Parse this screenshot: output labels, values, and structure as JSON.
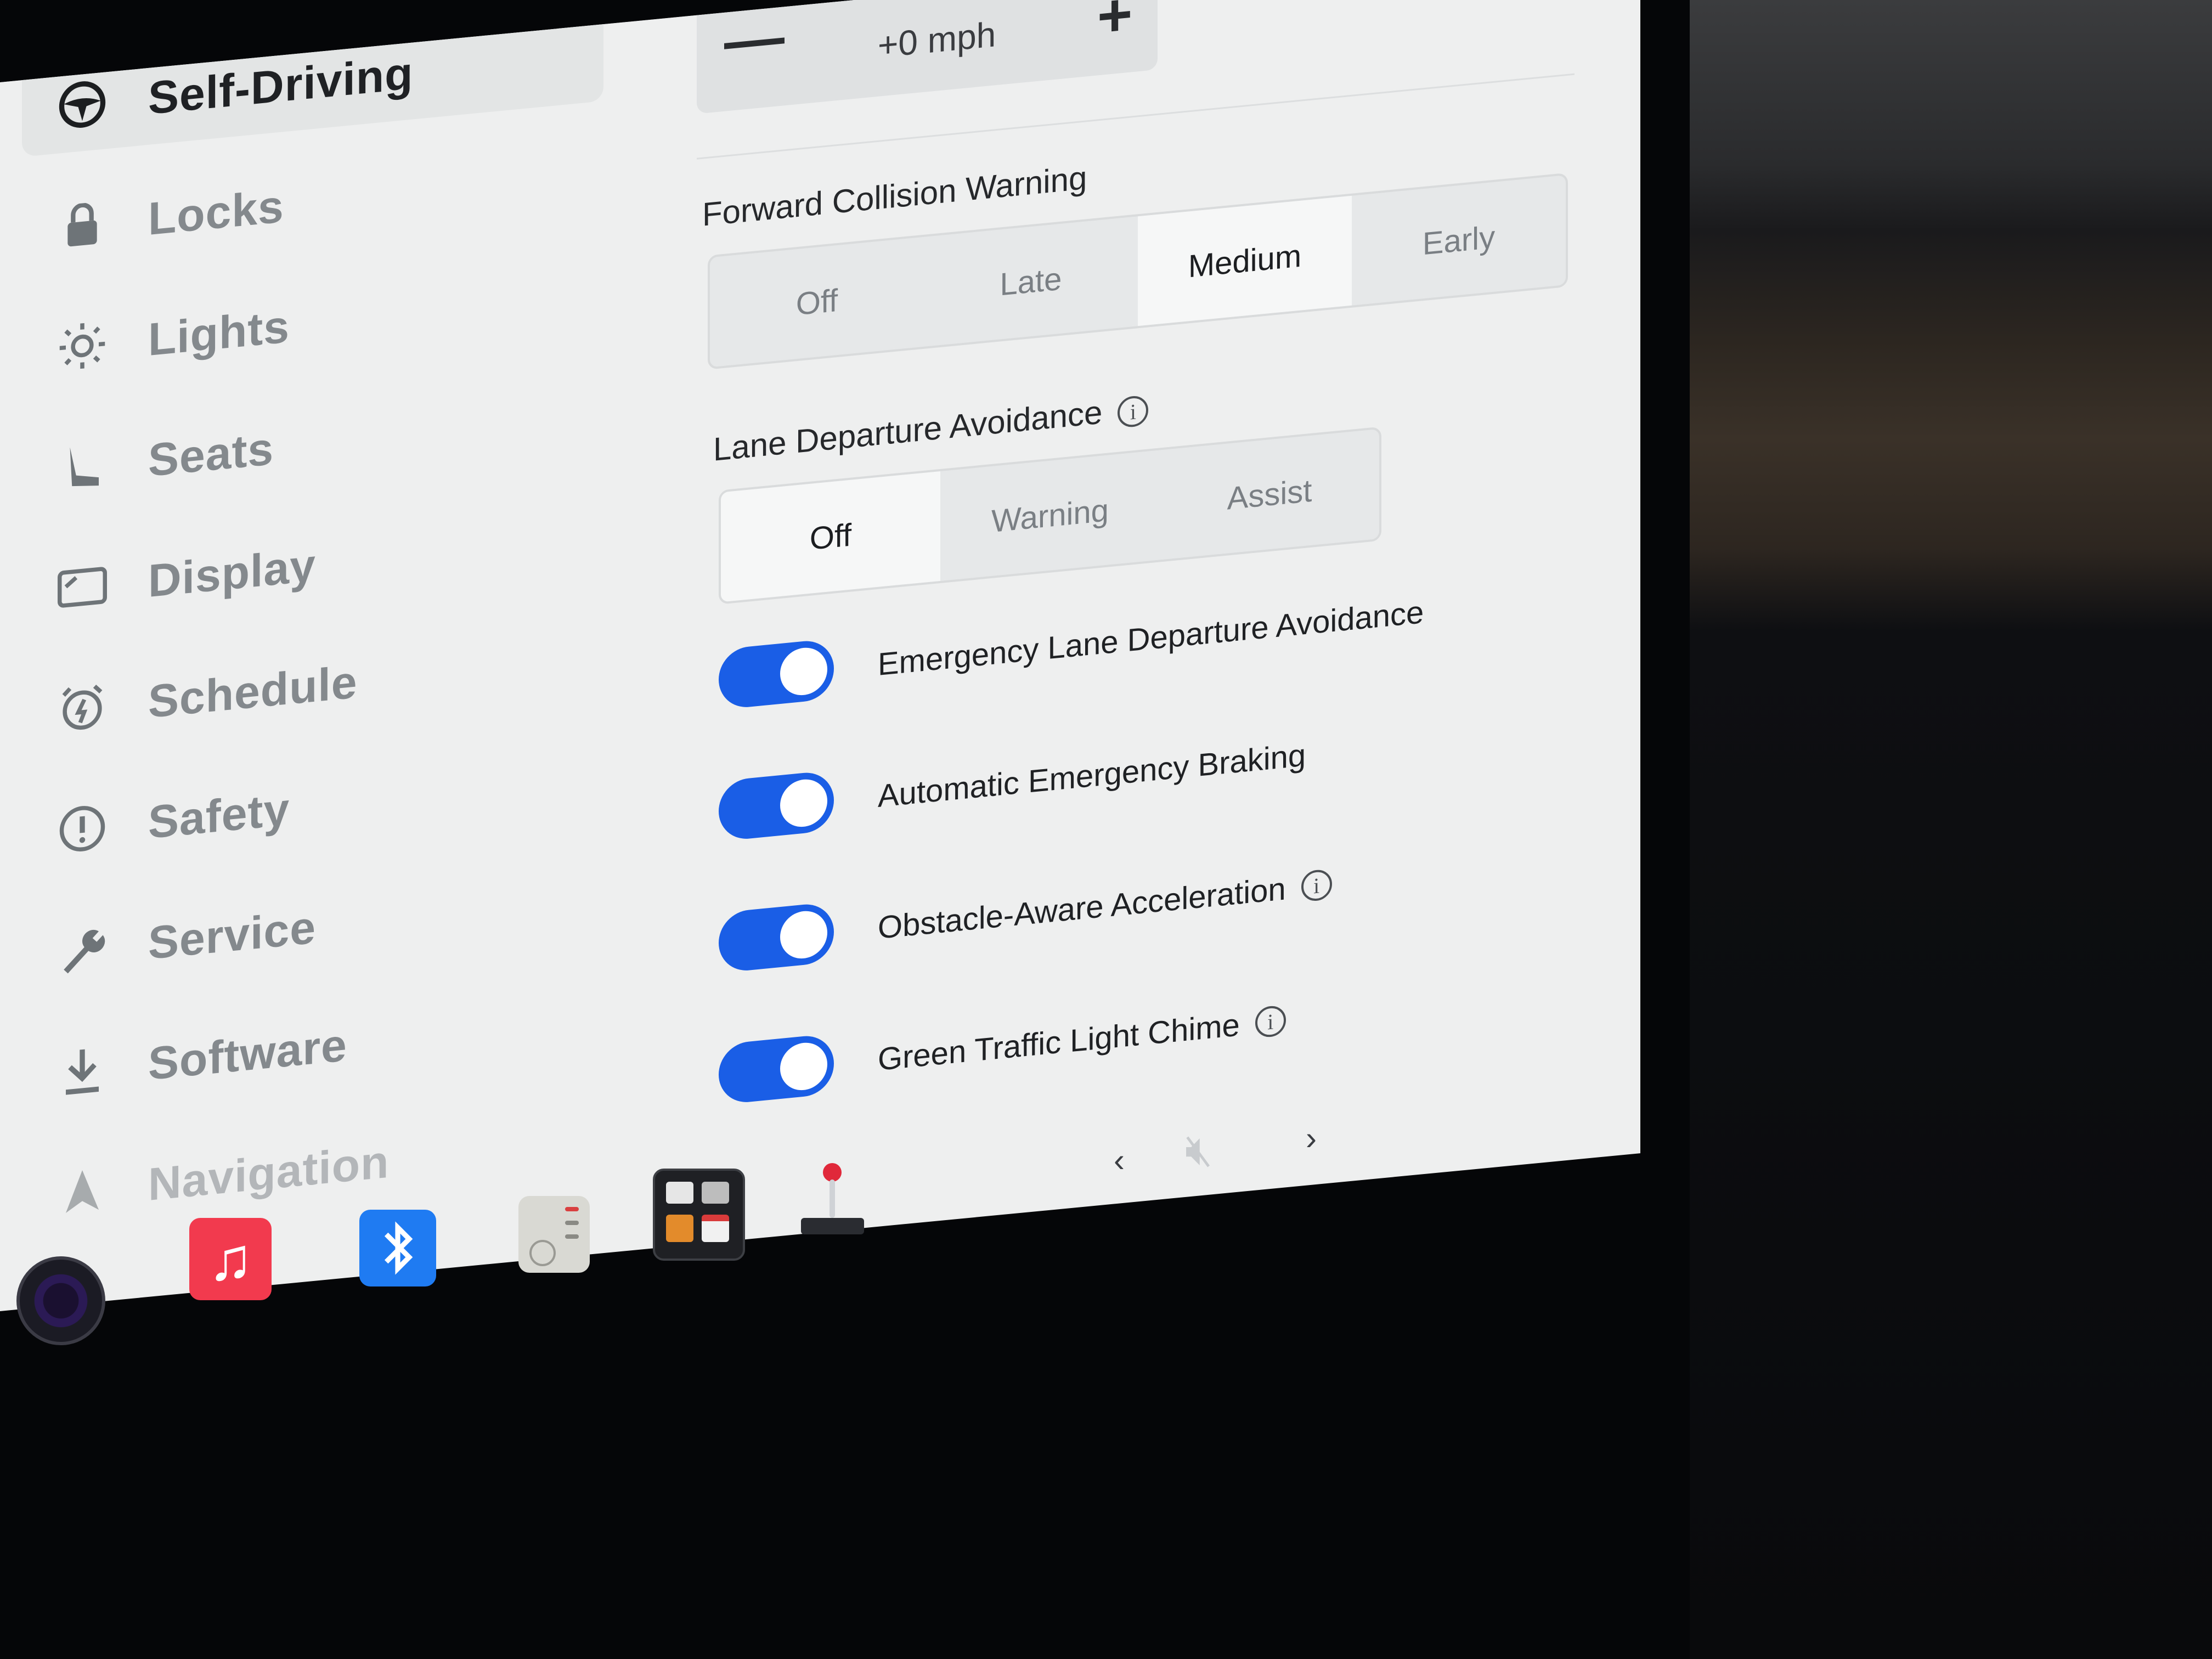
{
  "sidebar": {
    "items": [
      {
        "label": "Self-Driving",
        "icon": "steering-wheel-icon",
        "active": true
      },
      {
        "label": "Locks",
        "icon": "lock-icon"
      },
      {
        "label": "Lights",
        "icon": "sun-icon"
      },
      {
        "label": "Seats",
        "icon": "seat-icon"
      },
      {
        "label": "Display",
        "icon": "display-icon"
      },
      {
        "label": "Schedule",
        "icon": "alarm-clock-icon"
      },
      {
        "label": "Safety",
        "icon": "alert-circle-icon"
      },
      {
        "label": "Service",
        "icon": "wrench-icon"
      },
      {
        "label": "Software",
        "icon": "download-icon"
      },
      {
        "label": "Navigation",
        "icon": "navigation-arrow-icon"
      }
    ]
  },
  "speed_offset": {
    "minus": "—",
    "plus": "+",
    "value": "+0 mph"
  },
  "forward_collision": {
    "title": "Forward Collision Warning",
    "options": [
      "Off",
      "Late",
      "Medium",
      "Early"
    ],
    "selected": "Medium"
  },
  "lane_departure": {
    "title": "Lane Departure Avoidance",
    "options": [
      "Off",
      "Warning",
      "Assist"
    ],
    "selected": "Off"
  },
  "toggles": [
    {
      "label": "Emergency Lane Departure Avoidance",
      "on": true,
      "info": false
    },
    {
      "label": "Automatic Emergency Braking",
      "on": true,
      "info": false
    },
    {
      "label": "Obstacle-Aware Acceleration",
      "on": true,
      "info": true
    },
    {
      "label": "Green Traffic Light Chime",
      "on": true,
      "info": true
    }
  ],
  "info_glyph": "i",
  "dock": {
    "apps": [
      "camera-icon",
      "music-icon",
      "bluetooth-icon",
      "dashcam-icon",
      "toybox-icon",
      "joystick-icon"
    ],
    "volume_muted": true,
    "accent_color": "#1a5ee6"
  }
}
